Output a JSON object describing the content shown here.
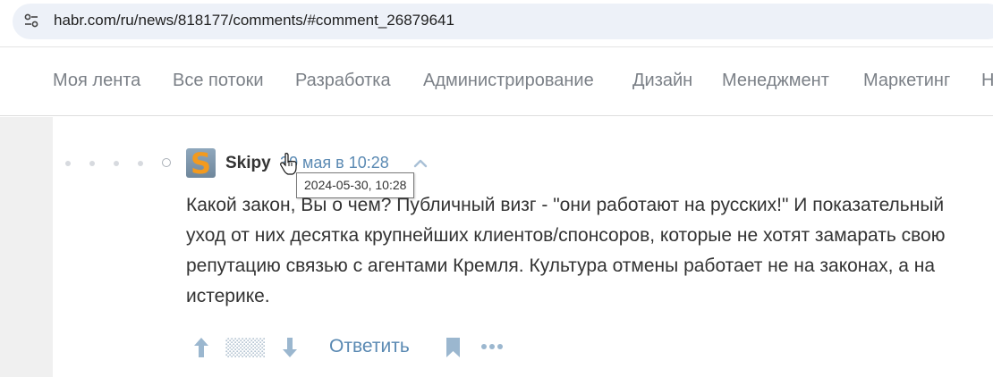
{
  "browser": {
    "url": "habr.com/ru/news/818177/comments/#comment_26879641",
    "site_icon": "tune-icon"
  },
  "nav": {
    "items": [
      "Моя лента",
      "Все потоки",
      "Разработка",
      "Администрирование",
      "Дизайн",
      "Менеджмент",
      "Маркетинг",
      "Н"
    ]
  },
  "comment": {
    "author": "Skipy",
    "avatar_letter": "S",
    "date": "30 мая в 10:28",
    "tooltip": "2024-05-30, 10:28",
    "body": "Какой закон, Вы о чем? Публичный визг - \"они работают на русских!\" И показательный уход от них десятка крупнейших клиентов/спонсоров, которые не хотят замарать свою репутацию связью с агентами Кремля. Культура отмены работает не на законах, а на истерике.",
    "actions": {
      "upvote_icon": "arrow-up-icon",
      "score_icon": "hidden-score-icon",
      "downvote_icon": "arrow-down-icon",
      "reply_label": "Ответить",
      "bookmark_icon": "bookmark-icon",
      "more_icon": "more-icon"
    }
  },
  "colors": {
    "link": "#5b8ab3",
    "nav_text": "#7b8087",
    "avatar_letter": "#f39a1e",
    "url_bar": "#edf1f8"
  }
}
